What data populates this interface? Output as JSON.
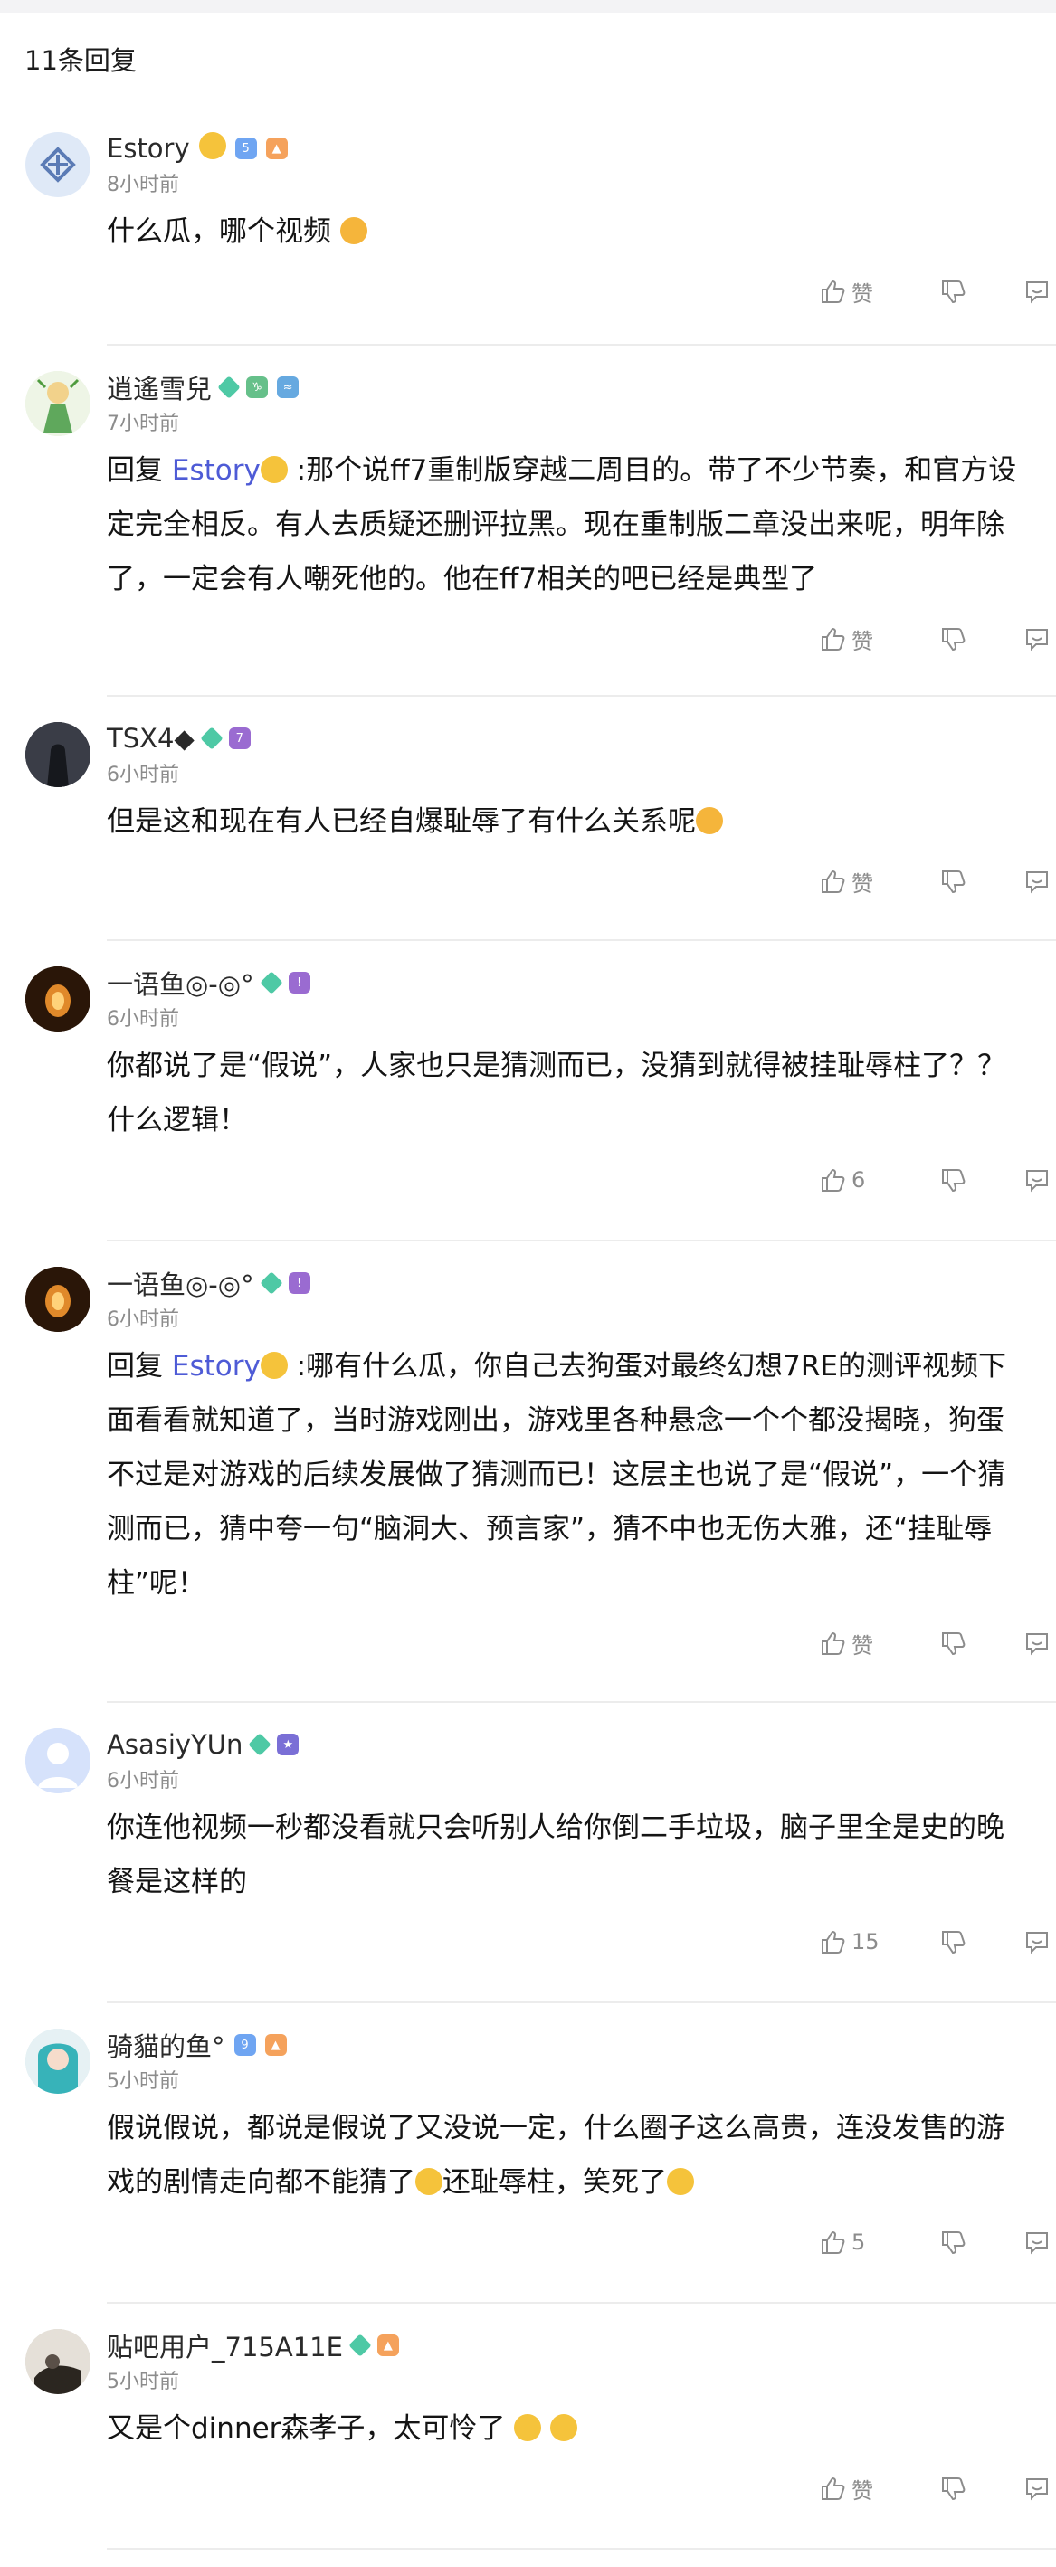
{
  "header": {
    "reply_count": "11条回复"
  },
  "labels": {
    "like": "赞"
  },
  "comments": [
    {
      "user": "Estory",
      "time": "8小时前",
      "text": "什么瓜，哪个视频",
      "likes": "赞"
    },
    {
      "user": "逍遙雪兒",
      "time": "7小时前",
      "reply_prefix": "回复 ",
      "mention": "Estory",
      "text": " :那个说ff7重制版穿越二周目的。带了不少节奏，和官方设定完全相反。有人去质疑还删评拉黑。现在重制版二章没出来呢，明年除了，一定会有人嘲死他的。他在ff7相关的吧已经是典型了",
      "likes": "赞"
    },
    {
      "user": "TSX4◆",
      "time": "6小时前",
      "text": "但是这和现在有人已经自爆耻辱了有什么关系呢",
      "likes": "赞"
    },
    {
      "user": "一语鱼◎-◎°",
      "time": "6小时前",
      "text": "你都说了是“假说”，人家也只是猜测而已，没猜到就得被挂耻辱柱了？？什么逻辑！",
      "likes": "6"
    },
    {
      "user": "一语鱼◎-◎°",
      "time": "6小时前",
      "reply_prefix": "回复 ",
      "mention": "Estory",
      "text": " :哪有什么瓜，你自己去狗蛋对最终幻想7RE的测评视频下面看看就知道了，当时游戏刚出，游戏里各种悬念一个个都没揭晓，狗蛋不过是对游戏的后续发展做了猜测而已！这层主也说了是“假说”，一个猜测而已，猜中夸一句“脑洞大、预言家”，猜不中也无伤大雅，还“挂耻辱柱”呢！",
      "likes": "赞"
    },
    {
      "user": "AsasiyYUn",
      "time": "6小时前",
      "text": "你连他视频一秒都没看就只会听别人给你倒二手垃圾，脑子里全是史的晚餐是这样的",
      "likes": "15"
    },
    {
      "user": "骑貓的鱼°",
      "time": "5小时前",
      "text": "假说假说，都说是假说了又没说一定，什么圈子这么高贵，连没发售的游戏的剧情走向都不能猜了",
      "text2": "还耻辱柱，笑死了",
      "likes": "5"
    },
    {
      "user": "贴吧用户_715A11E",
      "time": "5小时前",
      "text": "又是个dinner森孝子，太可怜了",
      "likes": "赞"
    }
  ],
  "colors": {
    "mention": "#4e5bd6",
    "muted": "#8c8c8c",
    "divider": "#ececec"
  }
}
